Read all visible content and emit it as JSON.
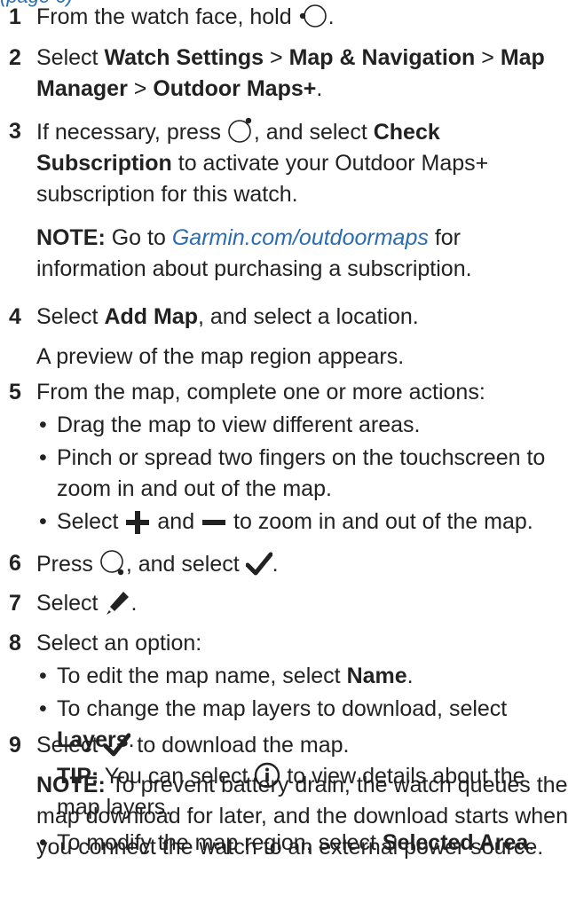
{
  "header_partial": "(page 6)",
  "steps": [
    {
      "num": "1",
      "pre": "From the watch face, hold",
      "icon": "watch-button-left-icon",
      "post": "."
    },
    {
      "num": "2",
      "pre": "Select",
      "b1": "Watch Settings",
      "sep1": " > ",
      "b2": "Map & Navigation",
      "sep2": " > ",
      "b3": "Map Manager",
      "sep3": " > ",
      "b4": "Outdoor Maps+",
      "post": "."
    },
    {
      "num": "3",
      "pre": "If necessary, press",
      "icon": "watch-button-top-icon",
      "mid": ", and select",
      "b1": "Check Subscription",
      "post": "to activate your Outdoor Maps+ subscription for this watch.",
      "note_label": "NOTE:",
      "note_pre": "Go to",
      "note_link": "Garmin.com/outdoormaps",
      "note_post": "for information about purchasing a subscription."
    },
    {
      "num": "4",
      "pre": "Select",
      "b1": "Add Map",
      "post": ", and select a location.",
      "sub": "A preview of the map region appears."
    },
    {
      "num": "5",
      "text": "From the map, complete one or more actions:",
      "bullets": [
        "Drag the map to view different areas.",
        "Pinch or spread two fingers on the touchscreen to zoom in and out of the map.",
        "Select",
        "and",
        "to zoom in and out of the map."
      ]
    },
    {
      "num": "6",
      "pre": "Press",
      "icon": "watch-button-bottom-icon",
      "mid": ", and select",
      "post": "."
    },
    {
      "num": "7",
      "pre": "Select",
      "post": "."
    },
    {
      "num": "8",
      "text": "Select an option:",
      "b_name_pre": "To edit the map name, select",
      "b_name": "Name",
      "b_layers_pre": "To change the map layers to download, select",
      "b_layers": "Layers",
      "tip_label": "TIP:",
      "tip_pre": "You can select",
      "tip_post": "to view details about the map layers.",
      "b_area_pre": "To modify the map region, select",
      "b_area": "Selected Area"
    },
    {
      "num": "9",
      "pre": "Select",
      "post": "to download the map.",
      "note_label": "NOTE:",
      "note_text": "To prevent battery drain, the watch queues the map download for later, and the download starts when you connect the watch to an external power source."
    }
  ],
  "bullet_char": "•",
  "period": "."
}
